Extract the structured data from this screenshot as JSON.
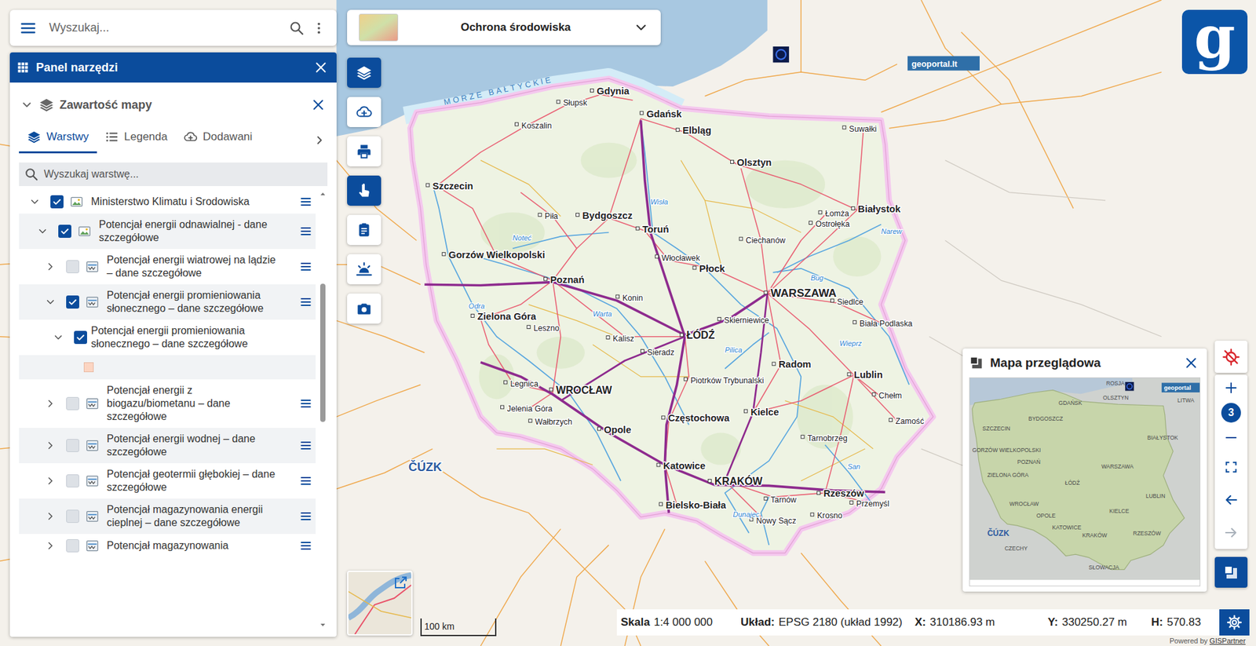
{
  "search": {
    "placeholder": "Wyszukaj..."
  },
  "theme_select": {
    "label": "Ochrona środowiska"
  },
  "logo": {
    "text": "g"
  },
  "toolbar": [
    {
      "selected": true
    },
    {
      "selected": false
    },
    {
      "selected": false
    },
    {
      "selected": true
    },
    {
      "selected": false
    },
    {
      "selected": false
    },
    {
      "selected": false
    }
  ],
  "tools_panel": {
    "title": "Panel narzędzi",
    "section": {
      "title": "Zawartość mapy",
      "expanded": true
    },
    "tabs": [
      {
        "label": "Warstwy",
        "selected": true
      },
      {
        "label": "Legenda",
        "selected": false
      },
      {
        "label": "Dodawani",
        "selected": false
      }
    ],
    "layer_search": {
      "placeholder": "Wyszukaj warstwę..."
    },
    "scrollbar": {
      "position": 0.2,
      "visible_share": 0.33
    },
    "layers": [
      {
        "kind": "group",
        "depth": 0,
        "label": "Ministerstwo Klimatu i Srodowiska",
        "checked": true,
        "expanded": true
      },
      {
        "kind": "group",
        "depth": 1,
        "label": "Potencjał energii odnawialnej - dane szczegółowe",
        "checked": true,
        "expanded": true
      },
      {
        "kind": "service",
        "depth": 2,
        "label": "Potencjał energii wiatrowej na lądzie – dane szczegółowe",
        "checked": false,
        "expanded": false
      },
      {
        "kind": "service",
        "depth": 2,
        "label": "Potencjał energii promieniowania słonecznego – dane szczegółowe",
        "checked": true,
        "expanded": true
      },
      {
        "kind": "sublayer",
        "depth": 3,
        "label": "Potencjał energii promieniowania słonecznego – dane szczegółowe",
        "checked": true,
        "expanded": true
      },
      {
        "kind": "legend",
        "depth": 4,
        "color": "#fcd5c2"
      },
      {
        "kind": "service",
        "depth": 2,
        "label": "Potencjał energii z biogazu/biometanu – dane szczegółowe",
        "checked": false,
        "expanded": false
      },
      {
        "kind": "service",
        "depth": 2,
        "label": "Potencjał energii wodnej – dane szczegółowe",
        "checked": false,
        "expanded": false
      },
      {
        "kind": "service",
        "depth": 2,
        "label": "Potencjał geotermii głębokiej – dane szczegółowe",
        "checked": false,
        "expanded": false
      },
      {
        "kind": "service",
        "depth": 2,
        "label": "Potencjał magazynowania energii cieplnej – dane szczegółowe",
        "checked": false,
        "expanded": false
      },
      {
        "kind": "service",
        "depth": 2,
        "label": "Potencjał magazynowania",
        "checked": false,
        "expanded": false
      }
    ]
  },
  "map": {
    "sea_label": "MORZE BAŁTYCKIE",
    "geoportal_badge": "geoportal.lt",
    "cuzk_logo": "ČÚZK",
    "cities": [
      {
        "name": "Gdynia",
        "kind": "city"
      },
      {
        "name": "Gdańsk",
        "kind": "city"
      },
      {
        "name": "Elbląg",
        "kind": "city"
      },
      {
        "name": "Słupsk",
        "kind": "town"
      },
      {
        "name": "Koszalin",
        "kind": "town"
      },
      {
        "name": "Szczecin",
        "kind": "city"
      },
      {
        "name": "Olsztyn",
        "kind": "city"
      },
      {
        "name": "Suwałki",
        "kind": "town"
      },
      {
        "name": "Białystok",
        "kind": "city"
      },
      {
        "name": "Łomża",
        "kind": "town"
      },
      {
        "name": "Ostrołęka",
        "kind": "town"
      },
      {
        "name": "Bydgoszcz",
        "kind": "city"
      },
      {
        "name": "Toruń",
        "kind": "city"
      },
      {
        "name": "Piła",
        "kind": "town"
      },
      {
        "name": "Gorzów Wielkopolski",
        "kind": "city"
      },
      {
        "name": "Poznań",
        "kind": "city"
      },
      {
        "name": "Konin",
        "kind": "town"
      },
      {
        "name": "Włocławek",
        "kind": "town"
      },
      {
        "name": "Płock",
        "kind": "city"
      },
      {
        "name": "Ciechanów",
        "kind": "town"
      },
      {
        "name": "WARSZAWA",
        "kind": "capital"
      },
      {
        "name": "Siedlce",
        "kind": "town"
      },
      {
        "name": "Biała Podlaska",
        "kind": "town"
      },
      {
        "name": "Lublin",
        "kind": "city"
      },
      {
        "name": "Chełm",
        "kind": "town"
      },
      {
        "name": "Zamość",
        "kind": "town"
      },
      {
        "name": "Radom",
        "kind": "city"
      },
      {
        "name": "Kielce",
        "kind": "city"
      },
      {
        "name": "Skierniewice",
        "kind": "town"
      },
      {
        "name": "ŁÓDŹ",
        "kind": "major"
      },
      {
        "name": "Sieradz",
        "kind": "town"
      },
      {
        "name": "Kalisz",
        "kind": "town"
      },
      {
        "name": "Leszno",
        "kind": "town"
      },
      {
        "name": "Zielona Góra",
        "kind": "city"
      },
      {
        "name": "Legnica",
        "kind": "town"
      },
      {
        "name": "WROCŁAW",
        "kind": "major"
      },
      {
        "name": "Jelenia Góra",
        "kind": "town"
      },
      {
        "name": "Wałbrzych",
        "kind": "town"
      },
      {
        "name": "Opole",
        "kind": "city"
      },
      {
        "name": "Częstochowa",
        "kind": "city"
      },
      {
        "name": "Piotrków Trybunalski",
        "kind": "town"
      },
      {
        "name": "Katowice",
        "kind": "city"
      },
      {
        "name": "Bielsko-Biała",
        "kind": "city"
      },
      {
        "name": "KRAKÓW",
        "kind": "major"
      },
      {
        "name": "Tarnów",
        "kind": "town"
      },
      {
        "name": "Tarnobrzeg",
        "kind": "town"
      },
      {
        "name": "Rzeszów",
        "kind": "city"
      },
      {
        "name": "Przemyśl",
        "kind": "town"
      },
      {
        "name": "Krosno",
        "kind": "town"
      },
      {
        "name": "Nowy Sącz",
        "kind": "town"
      }
    ],
    "rivers": [
      "Wisła",
      "Odra",
      "Warta",
      "Noteć",
      "Narew",
      "Wieprz",
      "San",
      "Dunajec",
      "Bug",
      "Pilica"
    ]
  },
  "map_controls": {
    "zoom": {
      "value": "3"
    },
    "back_disabled": false,
    "forward_disabled": true,
    "overview_selected": true
  },
  "overview": {
    "title": "Mapa przeglądowa",
    "geoportal_badge": "geoportal",
    "cuzk_logo": "ČÚZK",
    "labels": [
      "GDAŃSK",
      "OLSZTYN",
      "ROSJA",
      "LITWA",
      "SZCZECIN",
      "BYDGOSZCZ",
      "BIAŁYSTOK",
      "GORZÓW WIELKOPOLSKI",
      "POZNAŃ",
      "ZIELONA GÓRA",
      "WARSZAWA",
      "ŁÓDŹ",
      "LUBLIN",
      "WROCŁAW",
      "OPOLE",
      "KIELCE",
      "KATOWICE",
      "KRAKÓW",
      "RZESZÓW",
      "CZECHY",
      "SŁOWACJA"
    ]
  },
  "scale_bar": {
    "label": "100 km"
  },
  "status_bar": {
    "scale_label": "Skala",
    "scale": "1:4 000 000",
    "crs_label": "Układ:",
    "crs": "EPSG 2180 (układ 1992)",
    "x_label": "X:",
    "x": "310186.93 m",
    "y_label": "Y:",
    "y": "330250.27 m",
    "h_label": "H:",
    "h": "570.83"
  },
  "footer": {
    "prefix": "Powered by",
    "link": "GISPartner"
  }
}
